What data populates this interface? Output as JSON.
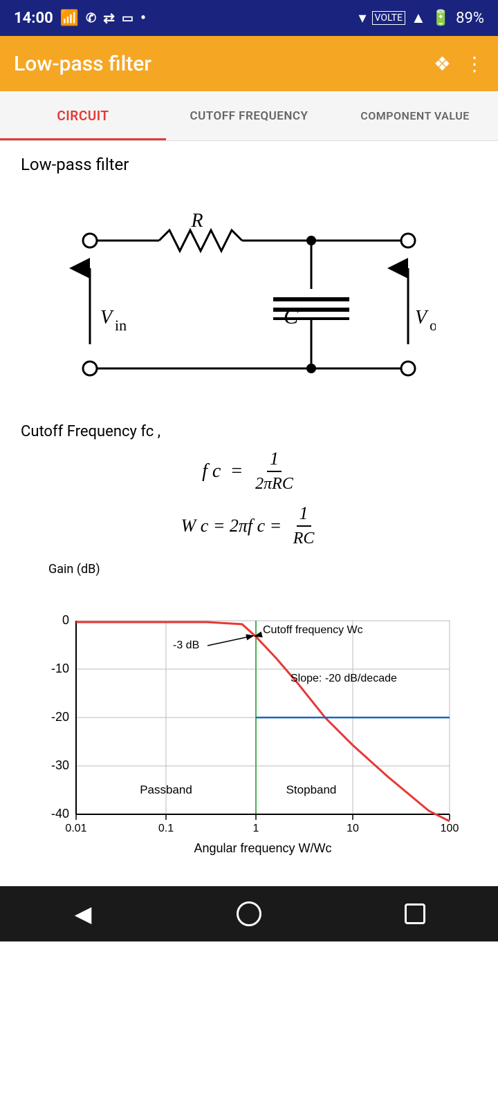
{
  "statusBar": {
    "time": "14:00",
    "battery": "89%"
  },
  "appBar": {
    "title": "Low-pass filter",
    "shareIcon": "share",
    "moreIcon": "more"
  },
  "tabs": [
    {
      "id": "circuit",
      "label": "CIRCUIT",
      "active": true
    },
    {
      "id": "cutoff",
      "label": "CUTOFF FREQUENCY",
      "active": false
    },
    {
      "id": "component",
      "label": "COMPONENT VALUE",
      "active": false
    }
  ],
  "circuit": {
    "sectionTitle": "Low-pass filter",
    "formulaLabel": "Cutoff Frequency fc ,",
    "formula1": "fc = 1 / (2πRC)",
    "formula2": "W c = 2πf c = 1/RC"
  },
  "chart": {
    "yLabel": "Gain (dB)",
    "xLabel": "Angular frequency W/Wc",
    "yValues": [
      "0",
      "-10",
      "-20",
      "-30",
      "-40"
    ],
    "xValues": [
      "0.01",
      "0.1",
      "1",
      "10",
      "100"
    ],
    "annotations": {
      "cutoff": "Cutoff frequency Wc",
      "slope": "Slope: -20 dB/decade",
      "minus3dB": "-3 dB",
      "passband": "Passband",
      "stopband": "Stopband"
    }
  },
  "bottomNav": {
    "back": "◀",
    "home": "",
    "square": ""
  }
}
